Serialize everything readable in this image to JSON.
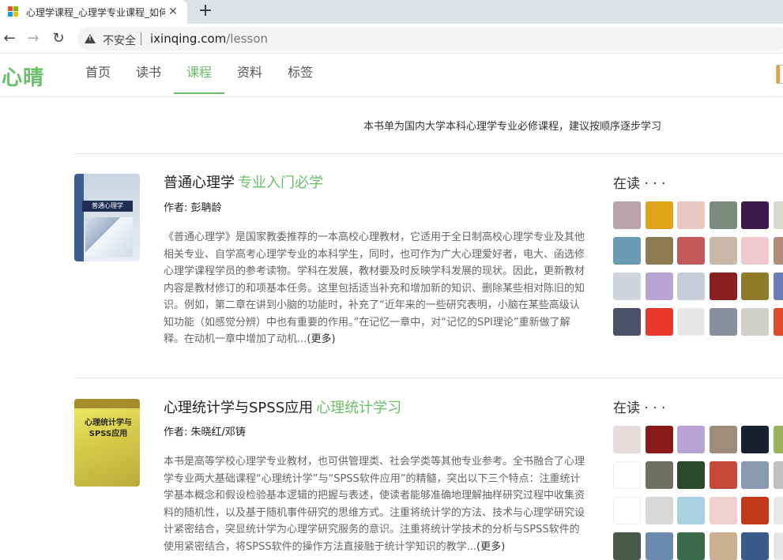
{
  "browser": {
    "tab_title": "心理学课程_心理学专业课程_如何",
    "close_glyph": "✕",
    "newtab_glyph": "+",
    "back_glyph": "←",
    "forward_glyph": "→",
    "reload_glyph": "↻",
    "insecure_label": "不安全",
    "url_host": "ixinqing.com",
    "url_path": "/lesson",
    "favicon_colors": [
      "#f25022",
      "#7fba00",
      "#00a4ef",
      "#ffb900"
    ]
  },
  "site": {
    "logo": "心晴",
    "nav": [
      "首页",
      "读书",
      "课程",
      "资料",
      "标签"
    ],
    "active_nav": "课程",
    "accent_color": "#6abf69"
  },
  "intro": "本书单为国内大学本科心理学专业必修课程，建议按顺序逐步学习",
  "books": [
    {
      "title": "普通心理学",
      "tag": "专业入门必学",
      "author": "作者: 彭聃龄",
      "cover_text": "普通心理学",
      "description": "《普通心理学》是国家教委推荐的一本高校心理教材，它适用于全日制高校心理学专业及其他相关专业、自学高考心理学专业的本科学生，同时，也可作为广大心理爱好者，电大、函选修心理学课程学员的参考读物。学科在发展，教材要及时反映学科发展的现状。因此，更新教材内容是教材修订的和项基本任务。这里包括适当补充和增加新的知识、删除某些相对陈旧的知识。例如，第二章在讲到小脑的功能时，补充了“近年来的一些研究表明，小脑在某些高级认知功能（如感觉分辨）中也有重要的作用。”在记忆一章中，对“记忆的SPI理论”重新做了解释。在动机一章中增加了动机...",
      "more": "(更多)",
      "reading_label": "在读 · · ·",
      "avatar_colors": [
        "#b9a3a8",
        "#e2a21a",
        "#e8c7c0",
        "#7a8b7e",
        "#3b1a4a",
        "#d9d9c9",
        "#6a9bb5",
        "#8c7b52",
        "#c25a5a",
        "#c9b7a8",
        "#f0c8cf",
        "#b08c7a",
        "#d0d4dc",
        "#b9a3d4",
        "#c8ccd8",
        "#8a1f1f",
        "#8f7a2a",
        "#6a7db5",
        "#4a5068",
        "#e8382c",
        "#e6e6e6",
        "#8a8fa0",
        "#cfd0cc",
        "#e24a2a"
      ]
    },
    {
      "title": "心理统计学与SPSS应用",
      "tag": "心理统计学习",
      "author": "作者: 朱晓红/邓铸",
      "cover_text": "心理统计学与SPSS应用",
      "description": "本书是高等学校心理学专业教材，也可供管理类、社会学类等其他专业参考。全书融合了心理学专业两大基础课程“心理统计学”与“SPSS软件应用”的精髓，突出以下三个特点：注重统计学基本概念和假设检验基本逻辑的把握与表述，使读者能够准确地理解抽样研究过程中收集资料的随机性，以及基于随机事件研究的思维方式。注重将统计学的方法、技术与心理学研究设计紧密结合，突显统计学为心理学研究服务的意识。注重将统计学技术的分析与SPSS软件的使用紧密结合，将SPSS软件的操作方法直接融于统计学知识的教学...",
      "more": "(更多)",
      "reading_label": "在读 · · ·",
      "avatar_colors": [
        "#e6dcdc",
        "#8a1a1a",
        "#b9a3d4",
        "#a08c7a",
        "#1a2030",
        "#9ab05a",
        "#ffffff",
        "#707060",
        "#2a4a2a",
        "#c44a3a",
        "#8a9ab0",
        "#c0c0c0",
        "#ffffff",
        "#d8d8d8",
        "#a8d0e0",
        "#f0d0d0",
        "#c03a1a",
        "#e8e8e8",
        "#4a5a4a",
        "#6a8ab0",
        "#3a6a4a",
        "#c8b090",
        "#3a5a8a",
        "#e6e6e6"
      ]
    }
  ]
}
